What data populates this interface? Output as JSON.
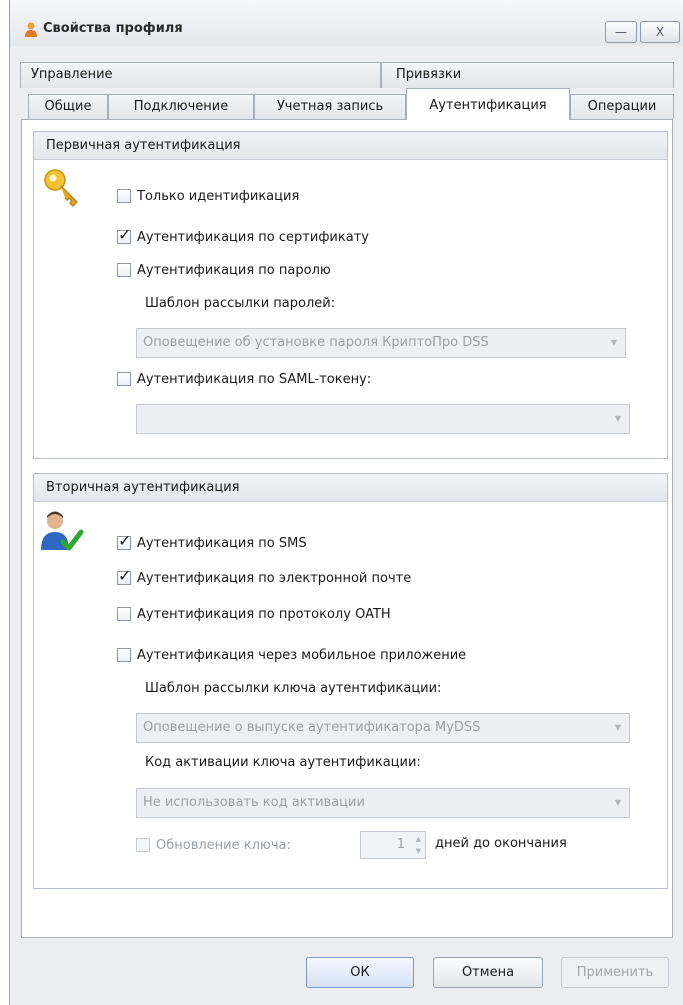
{
  "window": {
    "title": "Свойства профиля",
    "minimize_symbol": "—",
    "close_symbol": "X"
  },
  "tabs": {
    "row1": [
      "Управление",
      "Привязки"
    ],
    "row2": [
      "Общие",
      "Подключение",
      "Учетная запись",
      "Аутентификация",
      "Операции"
    ],
    "active": "Аутентификация"
  },
  "primary": {
    "header": "Первичная аутентификация",
    "icon": "key-icon",
    "only_identification": {
      "label": "Только идентификация",
      "checked": false
    },
    "cert_auth": {
      "label": "Аутентификация по сертификату",
      "checked": true
    },
    "password_auth": {
      "label": "Аутентификация по паролю",
      "checked": false
    },
    "password_template_label": "Шаблон рассылки паролей:",
    "password_template_value": "Оповещение об установке пароля КриптоПро DSS",
    "saml_auth": {
      "label": "Аутентификация по SAML-токену:",
      "checked": false
    },
    "saml_value": ""
  },
  "secondary": {
    "header": "Вторичная аутентификация",
    "icon": "user-check-icon",
    "sms_auth": {
      "label": "Аутентификация по SMS",
      "checked": true
    },
    "email_auth": {
      "label": "Аутентификация по электронной почте",
      "checked": true
    },
    "oath_auth": {
      "label": "Аутентификация по протоколу OATH",
      "checked": false
    },
    "mobile_auth": {
      "label": "Аутентификация через мобильное приложение",
      "checked": false
    },
    "key_template_label": "Шаблон рассылки ключа аутентификации:",
    "key_template_value": "Оповещение о выпуске аутентификатора MyDSS",
    "activation_code_label": "Код активации ключа аутентификации:",
    "activation_code_value": "Не использовать код активации",
    "key_update": {
      "label": "Обновление ключа:",
      "checked": false,
      "value": "1",
      "suffix": "дней до окончания"
    }
  },
  "footer": {
    "ok": "ОК",
    "cancel": "Отмена",
    "apply": "Применить"
  },
  "check_mark": "✓",
  "dropdown_arrow": "▼",
  "spin_up_arrow": "▲",
  "spin_down_arrow": "▼"
}
